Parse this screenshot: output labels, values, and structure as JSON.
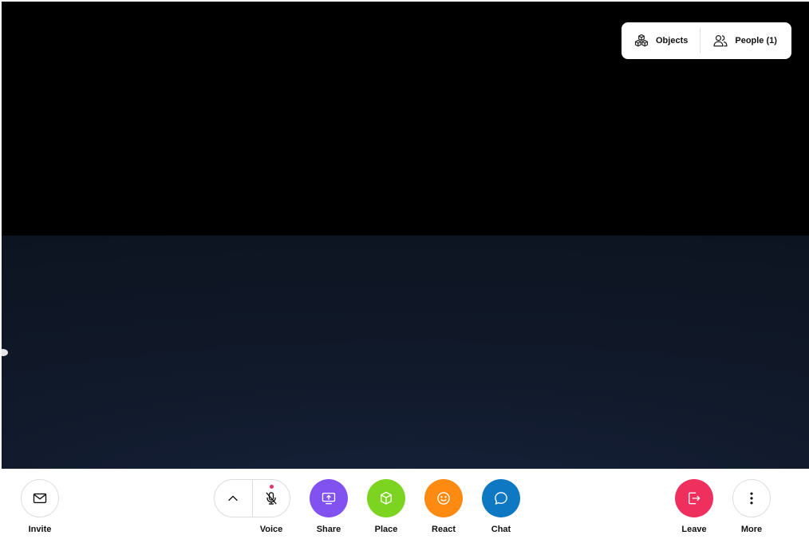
{
  "top_panel": {
    "objects_label": "Objects",
    "people_label": "People (1)"
  },
  "toolbar": {
    "invite_label": "Invite",
    "voice_label": "Voice",
    "share_label": "Share",
    "place_label": "Place",
    "react_label": "React",
    "chat_label": "Chat",
    "leave_label": "Leave",
    "more_label": "More"
  },
  "icons": {
    "objects": "cubes-icon",
    "people": "people-icon",
    "invite": "envelope-icon",
    "expand": "chevron-up-icon",
    "voice": "microphone-muted-icon",
    "share": "screen-share-icon",
    "place": "cube-icon",
    "react": "smiley-icon",
    "chat": "chat-bubble-icon",
    "leave": "exit-icon",
    "more": "vertical-dots-icon"
  },
  "colors": {
    "share": "#8152f0",
    "place": "#7cd320",
    "react": "#ff8a12",
    "chat": "#0e78c2",
    "leave": "#ef2f5d",
    "voice_indicator": "#e8326a"
  }
}
